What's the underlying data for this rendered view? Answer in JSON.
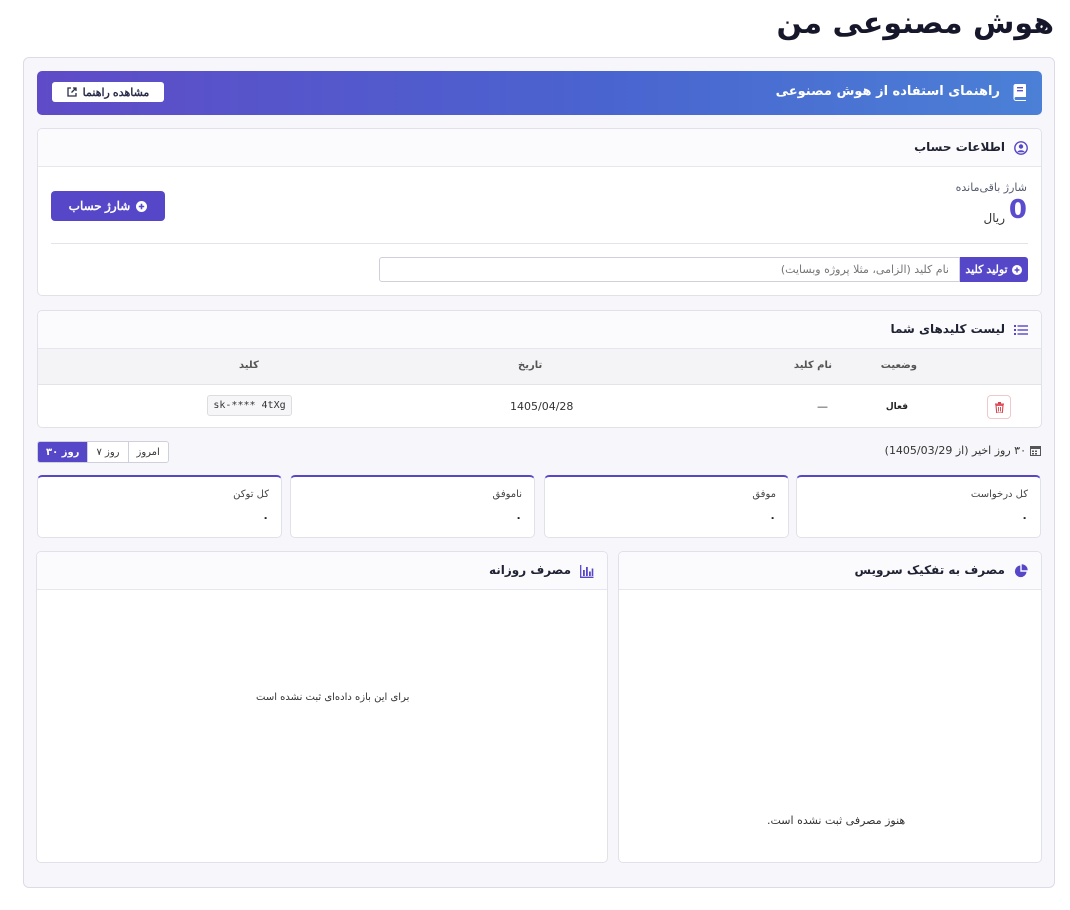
{
  "page": {
    "title": "هوش مصنوعی من"
  },
  "banner": {
    "title": "راهنمای استفاده از هوش مصنوعی",
    "button": "مشاهده راهنما",
    "icon": "book-icon",
    "button_icon": "external-link-icon"
  },
  "account": {
    "title": "اطلاعات حساب",
    "icon": "user-circle-icon",
    "balance_label": "شارژ باقی‌مانده",
    "balance_value": "0",
    "currency": "ریال",
    "charge_button": "شارژ حساب",
    "key_button": "تولید کلید",
    "key_placeholder": "نام کلید (الزامی، مثلا پروژه وبسایت)",
    "key_value": ""
  },
  "keys": {
    "title": "لیست کلیدهای شما",
    "icon": "list-icon",
    "columns": {
      "status": "وضعیت",
      "name": "نام کلید",
      "date": "تاریخ",
      "key": "کلید"
    },
    "rows": [
      {
        "status": "فعال",
        "name": "—",
        "date": "1405/04/28",
        "key": "sk-**** 4tXg"
      }
    ]
  },
  "range": {
    "label": "۳۰ روز اخیر (از 1405/03/29)",
    "options": [
      {
        "label": "امروز",
        "active": false
      },
      {
        "label": "۷ روز",
        "active": false
      },
      {
        "label": "۳۰ روز",
        "active": true
      }
    ]
  },
  "stats": [
    {
      "label": "کل درخواست",
      "value": "۰"
    },
    {
      "label": "موفق",
      "value": "۰"
    },
    {
      "label": "ناموفق",
      "value": "۰"
    },
    {
      "label": "کل توکن",
      "value": "۰"
    }
  ],
  "service_usage": {
    "title": "مصرف به تفکیک سرویس",
    "icon": "pie-chart-icon",
    "empty": "هنوز مصرفی ثبت نشده است."
  },
  "daily_usage": {
    "title": "مصرف روزانه",
    "icon": "bar-chart-icon",
    "empty": "برای این بازه داده‌ای ثبت نشده است"
  },
  "colors": {
    "accent": "#5647c9",
    "banner_from": "#5f4bc7",
    "banner_to": "#4b80d6",
    "danger": "#d9434e"
  }
}
